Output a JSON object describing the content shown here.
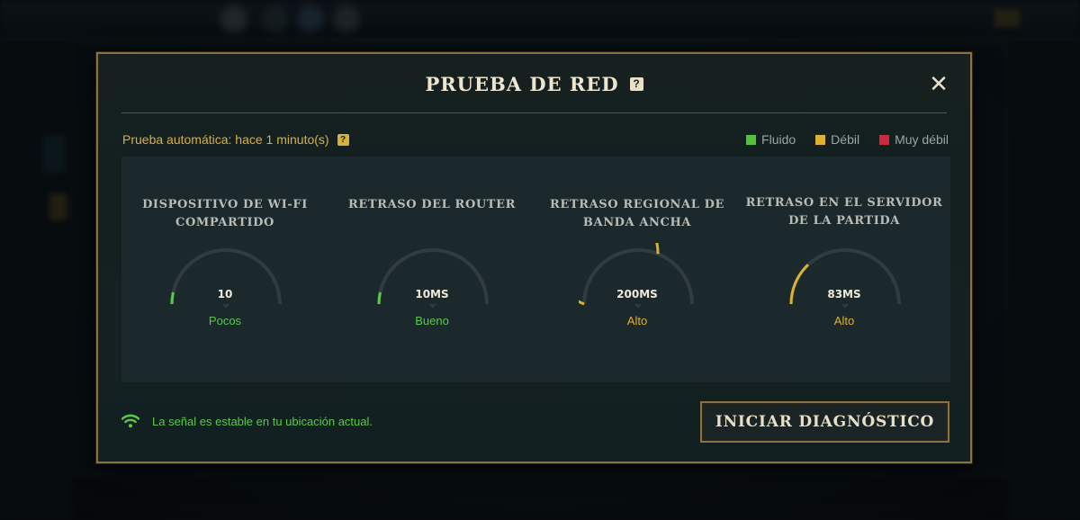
{
  "dialog": {
    "title": "PRUEBA DE RED",
    "title_help_icon": "help-icon",
    "close_icon": "close-icon",
    "auto_test_text": "Prueba automática: hace 1 minuto(s)",
    "auto_test_help_icon": "help-icon",
    "legend": [
      {
        "label": "Fluido",
        "color": "#4fc23a"
      },
      {
        "label": "Débil",
        "color": "#e0b030"
      },
      {
        "label": "Muy débil",
        "color": "#c92a3c"
      }
    ],
    "metrics": [
      {
        "title_line1": "DISPOSITIVO DE WI-FI",
        "title_line2": "COMPARTIDO",
        "value": "10",
        "status": "Pocos",
        "status_color": "#59c94b",
        "level": 0.07
      },
      {
        "title_line1": "RETRASO DEL ROUTER",
        "title_line2": "",
        "value": "10MS",
        "status": "Bueno",
        "status_color": "#59c94b",
        "level": 0.07
      },
      {
        "title_line1": "RETRASO REGIONAL DE",
        "title_line2": "BANDA ANCHA",
        "value": "200MS",
        "status": "Alto",
        "status_color": "#e0b030",
        "level": 0.62
      },
      {
        "title_line1": "RETRASO EN EL SERVIDOR",
        "title_line2": "DE LA PARTIDA",
        "value": "83MS",
        "status": "Alto",
        "status_color": "#e0b030",
        "level": 0.26
      }
    ],
    "signal_icon": "wifi-icon",
    "signal_text": "La señal es estable en tu ubicación actual.",
    "diagnose_button": "INICIAR DIAGNÓSTICO"
  },
  "colors": {
    "gold_border": "#8a7242",
    "good": "#59c94b",
    "warn": "#e0b030",
    "gauge_track": "#303c3f"
  }
}
